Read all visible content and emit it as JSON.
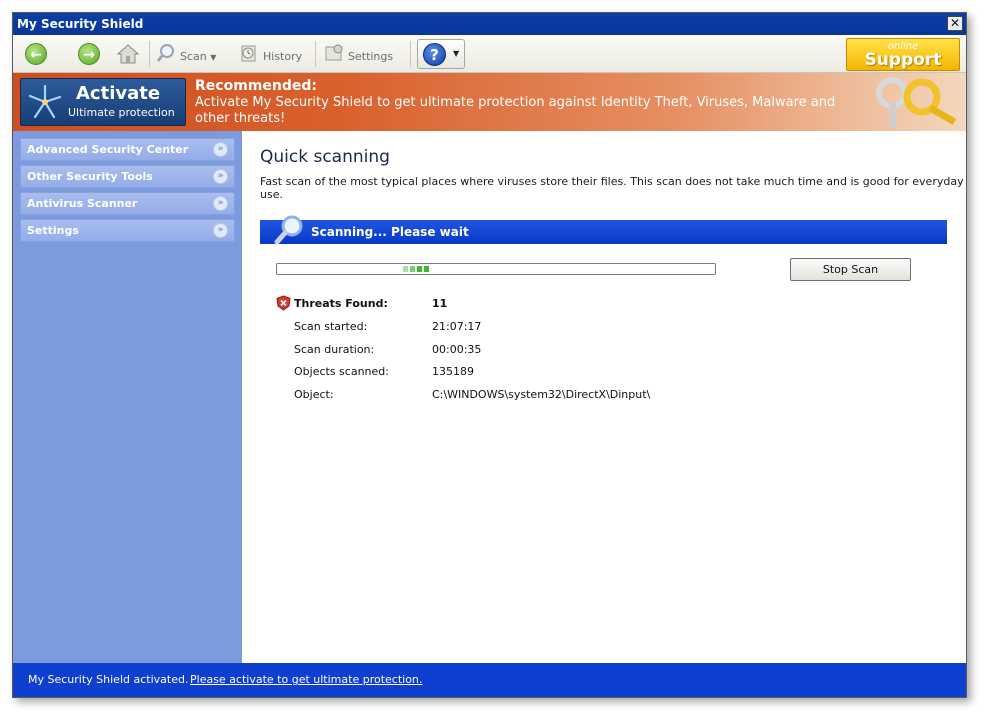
{
  "window": {
    "title": "My Security Shield",
    "close_glyph": "✕"
  },
  "toolbar": {
    "back_icon": "back-arrow-icon",
    "forward_icon": "forward-arrow-icon",
    "home_icon": "home-icon",
    "scan_label": "Scan",
    "history_label": "History",
    "settings_label": "Settings",
    "help_glyph": "?",
    "support_small": "online",
    "support_big": "Support"
  },
  "banner": {
    "activate_title": "Activate",
    "activate_subtitle": "Ultimate protection",
    "recommended": "Recommended:",
    "message": "Activate My Security Shield to get ultimate protection against Identity Theft, Viruses, Malware and other threats!"
  },
  "sidebar": {
    "items": [
      {
        "label": "Advanced Security Center"
      },
      {
        "label": "Other Security Tools"
      },
      {
        "label": "Antivirus Scanner"
      },
      {
        "label": "Settings"
      }
    ]
  },
  "main": {
    "title": "Quick scanning",
    "description": "Fast scan of the most typical places where viruses store their files. This scan does not take much time and is good for everyday use.",
    "scan_status": "Scanning... Please wait",
    "stop_button": "Stop Scan",
    "threats_label": "Threats Found:",
    "threats_value": "11",
    "rows": [
      {
        "label": "Scan started:",
        "value": "21:07:17"
      },
      {
        "label": "Scan duration:",
        "value": "00:00:35"
      },
      {
        "label": "Objects scanned:",
        "value": "135189"
      },
      {
        "label": "Object:",
        "value": "C:\\WINDOWS\\system32\\DirectX\\Dinput\\"
      }
    ]
  },
  "status": {
    "text": "My Security Shield activated.",
    "link": "Please activate to get ultimate protection."
  },
  "colors": {
    "titlebar": "#0a3fa8",
    "banner": "#cf4e1e",
    "sidebar": "#7b9bde",
    "scan_bar": "#0839c9",
    "statusbar": "#0f3fd0"
  }
}
